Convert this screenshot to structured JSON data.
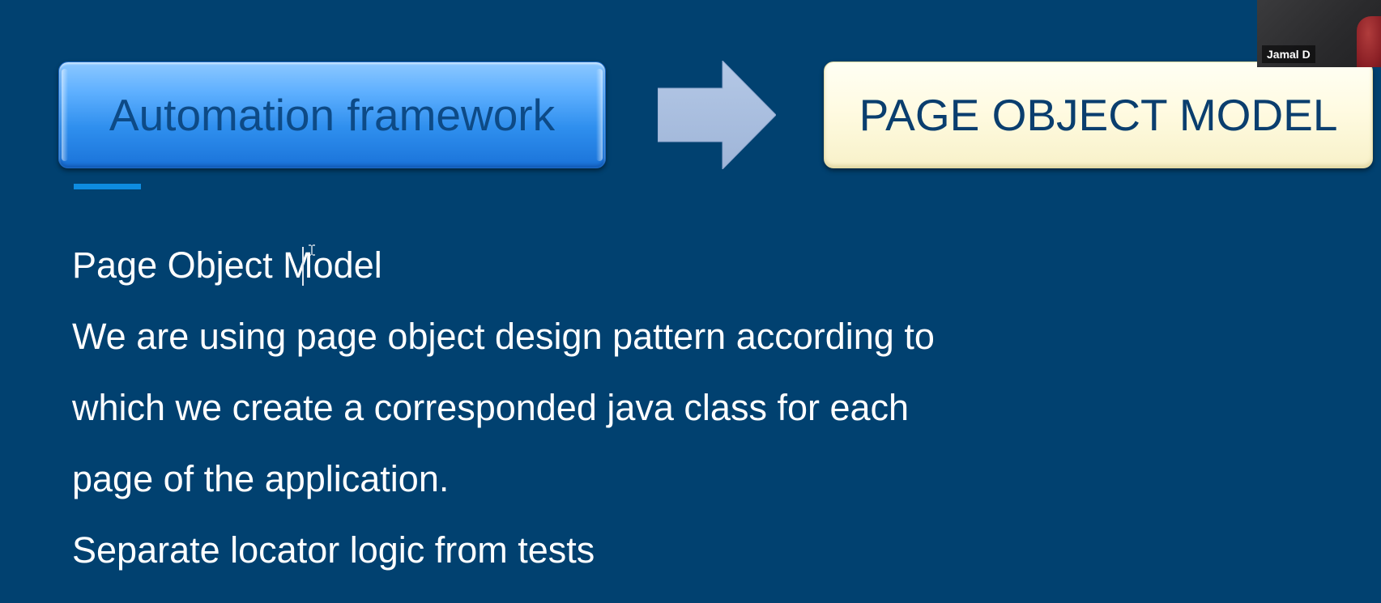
{
  "slide": {
    "header_left_box": "Automation framework",
    "header_right_box": "PAGE OBJECT MODEL",
    "lines": [
      "Page Object Model",
      "We are using page object design pattern according to",
      "which we create a corresponded java class for each",
      "page of the application.",
      "Separate locator logic from tests"
    ]
  },
  "video": {
    "participant_name": "Jamal D"
  },
  "colors": {
    "background": "#014170",
    "left_box": "#3a98f2",
    "right_box": "#fffbe2",
    "arrow": "#a9bedf",
    "body_text": "#ffffff"
  }
}
